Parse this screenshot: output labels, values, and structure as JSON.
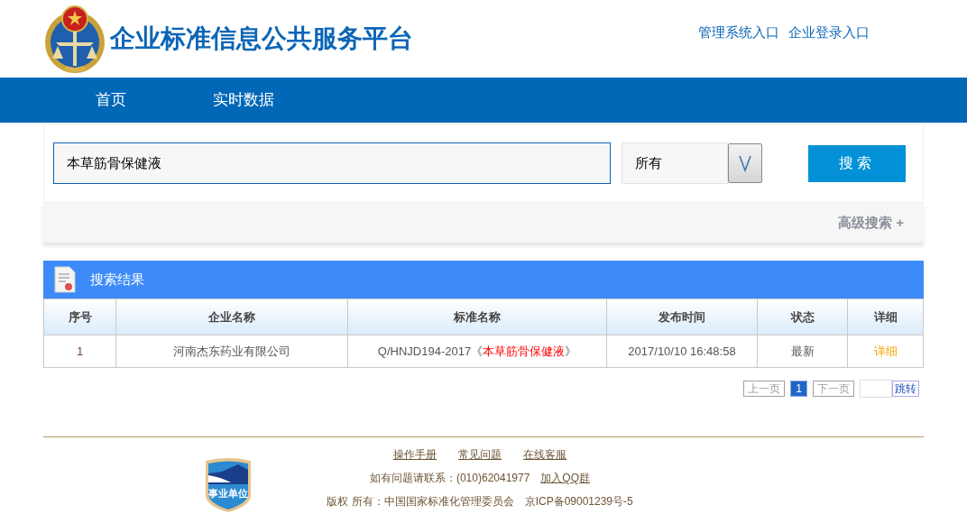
{
  "header": {
    "title": "企业标准信息公共服务平台",
    "links": [
      "管理系统入口",
      "企业登录入口"
    ]
  },
  "nav": {
    "items": [
      {
        "label": "首页",
        "selected": false
      },
      {
        "label": "实时数据",
        "selected": false
      }
    ]
  },
  "search": {
    "value": "本草筋骨保健液",
    "scope": "所有",
    "button": "搜索",
    "advanced": "高级搜索 +"
  },
  "results": {
    "title": "搜索结果",
    "columns": [
      "序号",
      "企业名称",
      "标准名称",
      "发布时间",
      "状态",
      "详细"
    ],
    "rows": [
      {
        "index": "1",
        "company": "河南杰东药业有限公司",
        "standard": [
          {
            "text": "Q/HNJD194-2017《",
            "highlight": false
          },
          {
            "text": "本草筋骨保健液",
            "highlight": true
          },
          {
            "text": "》",
            "highlight": false
          }
        ],
        "time": "2017/10/10 16:48:58",
        "status": "最新",
        "detail": "详细"
      }
    ]
  },
  "pagination": {
    "prev": "上一页",
    "pages": [
      {
        "label": "1",
        "selected": true
      }
    ],
    "next": "下一页",
    "jump": "跳转"
  },
  "footer": {
    "links": [
      "操作手册",
      "常见问题",
      "在线客服"
    ],
    "contact": "如有问题请联系：(010)62041977",
    "qq": "加入QQ群",
    "copyright": "版权 所有：中国国家标准化管理委员会",
    "icp": "京ICP备09001239号-5",
    "badge": "事业单位"
  }
}
